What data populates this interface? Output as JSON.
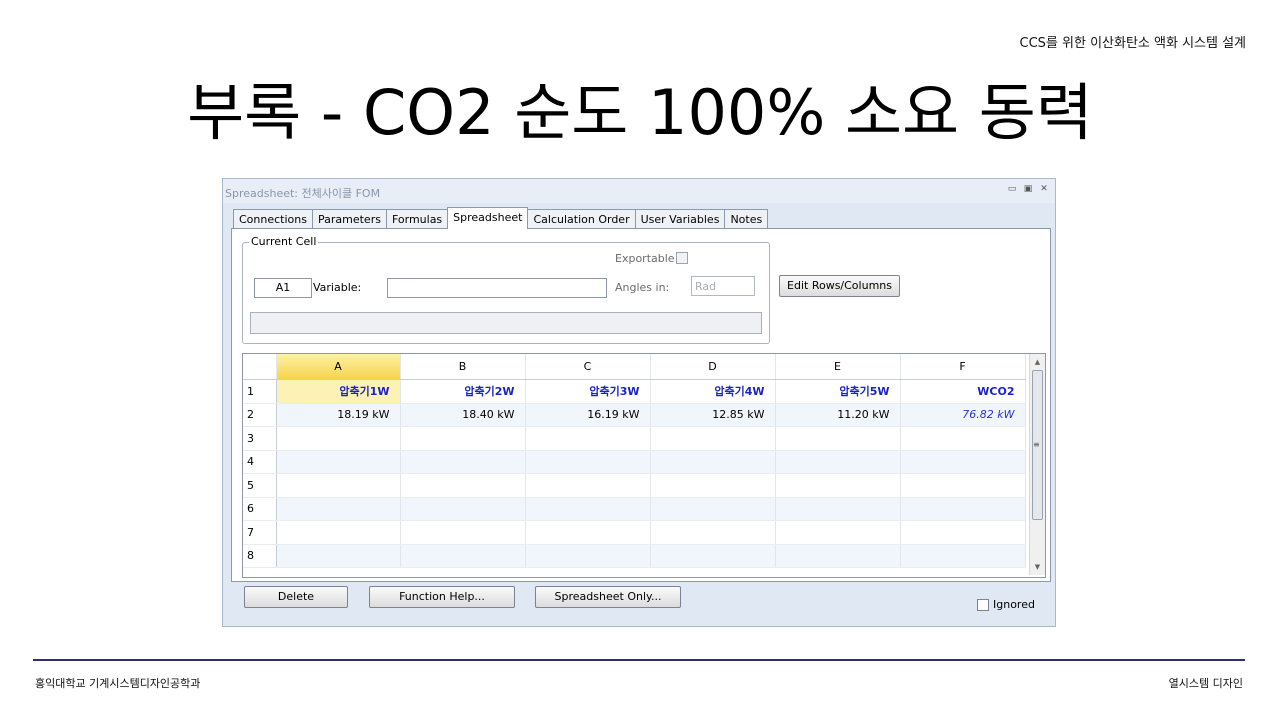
{
  "slide": {
    "header": "CCS를 위한 이산화탄소 액화 시스템 설계",
    "title": "부록 - CO2 순도 100% 소요 동력",
    "footer_left": "홍익대학교 기계시스템디자인공학과",
    "footer_right": "열시스템 디자인"
  },
  "window": {
    "title": "Spreadsheet: 전체사이클 FOM",
    "controls": [
      "minimize-icon",
      "restore-icon",
      "close-icon"
    ],
    "tabs": [
      {
        "label": "Connections"
      },
      {
        "label": "Parameters"
      },
      {
        "label": "Formulas"
      },
      {
        "label": "Spreadsheet",
        "active": true
      },
      {
        "label": "Calculation Order"
      },
      {
        "label": "User Variables"
      },
      {
        "label": "Notes"
      }
    ],
    "current_cell": {
      "legend": "Current Cell",
      "cell_ref": "A1",
      "variable_label": "Variable:",
      "variable_value": "",
      "exportable_label": "Exportable",
      "angles_label": "Angles in:",
      "angles_value": "Rad",
      "formula": ""
    },
    "edit_button": "Edit Rows/Columns",
    "grid": {
      "columns": [
        "A",
        "B",
        "C",
        "D",
        "E",
        "F"
      ],
      "selected_column": "A",
      "rows": [
        {
          "num": "1",
          "cells": [
            "압축기1W",
            "압축기2W",
            "압축기3W",
            "압축기4W",
            "압축기5W",
            "WCO2"
          ]
        },
        {
          "num": "2",
          "cells": [
            "18.19 kW",
            "18.40 kW",
            "16.19 kW",
            "12.85 kW",
            "11.20 kW",
            "76.82 kW"
          ]
        },
        {
          "num": "3",
          "cells": [
            "",
            "",
            "",
            "",
            "",
            ""
          ]
        },
        {
          "num": "4",
          "cells": [
            "",
            "",
            "",
            "",
            "",
            ""
          ]
        },
        {
          "num": "5",
          "cells": [
            "",
            "",
            "",
            "",
            "",
            ""
          ]
        },
        {
          "num": "6",
          "cells": [
            "",
            "",
            "",
            "",
            "",
            ""
          ]
        },
        {
          "num": "7",
          "cells": [
            "",
            "",
            "",
            "",
            "",
            ""
          ]
        },
        {
          "num": "8",
          "cells": [
            "",
            "",
            "",
            "",
            "",
            ""
          ]
        }
      ]
    },
    "buttons": {
      "delete": "Delete",
      "function_help": "Function Help...",
      "spreadsheet_only": "Spreadsheet Only..."
    },
    "ignored_label": "Ignored"
  }
}
